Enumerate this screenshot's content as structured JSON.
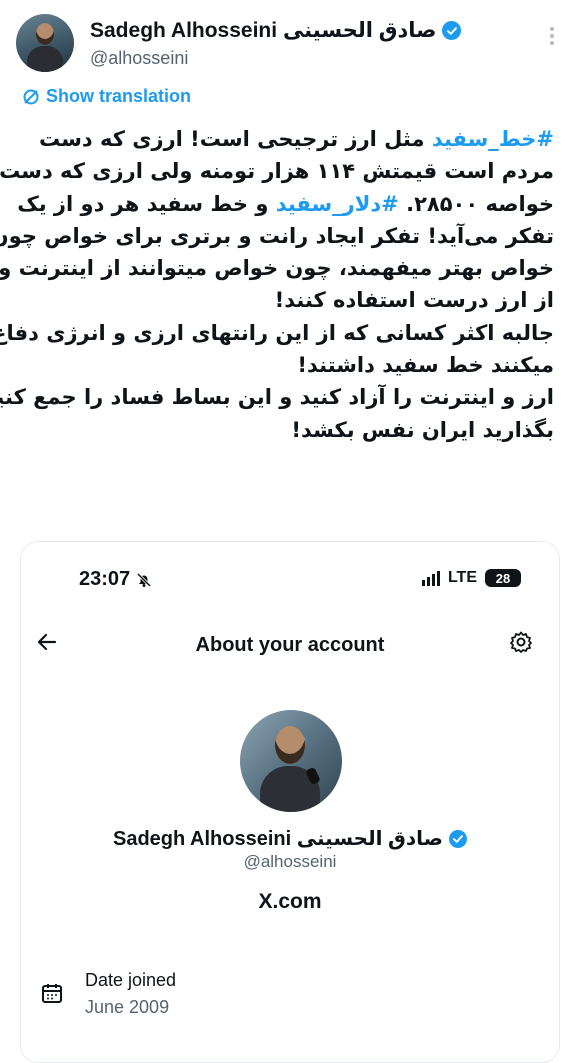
{
  "author": {
    "name": "Sadegh Alhosseini صادق الحسینی",
    "handle": "@alhosseini"
  },
  "translate_label": "Show translation",
  "tweet": {
    "lines": [
      {
        "tag": "#خط_سفید",
        "text": " مثل ارز ترجیحی است! ارزی که دست"
      },
      {
        "text": "مردم است قیمتش ۱۱۴ هزار تومنه ولی ارزی که دست"
      },
      {
        "text": "خواصه ۲۸۵۰۰. ",
        "tag": "#دلار_سفید",
        "text2": " و خط سفید هر دو از یک"
      },
      {
        "text": "تفکر می‌آید! تفکر ایجاد رانت و برتری برای خواص چون"
      },
      {
        "text": "خواص بهتر میفهمند، چون خواص میتوانند از اینترنت و"
      },
      {
        "text": "از ارز درست استفاده کنند!"
      },
      {
        "text": "جالبه اکثر کسانی که از این رانتهای ارزی و انرژی دفاع"
      },
      {
        "text": "میکنند خط سفید داشتند!"
      },
      {
        "text": "ارز و اینترنت را آزاد کنید و این بساط فساد را جمع کنید."
      },
      {
        "text": "بگذارید ایران نفس بکشد!"
      }
    ]
  },
  "screenshot": {
    "status_time": "23:07",
    "network": "LTE",
    "battery": "28",
    "title": "About your account",
    "name": "Sadegh Alhosseini صادق الحسینی",
    "handle": "@alhosseini",
    "site": "X.com",
    "date_label": "Date joined",
    "date_value": "June 2009"
  },
  "colors": {
    "accent": "#1d9bf0",
    "text": "#0f1419",
    "muted": "#536471"
  }
}
